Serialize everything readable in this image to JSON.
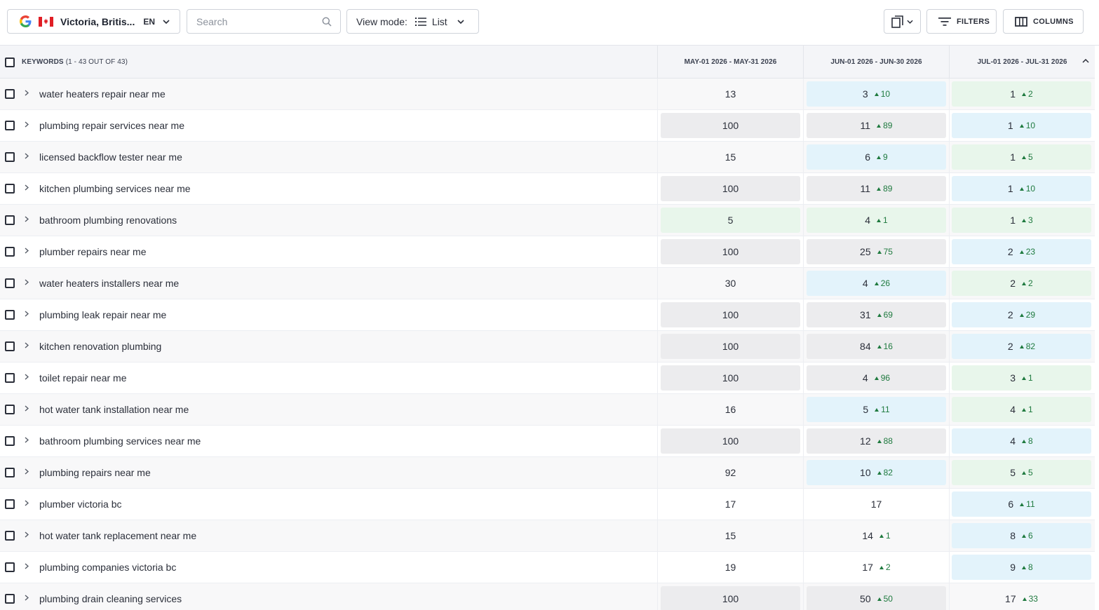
{
  "toolbar": {
    "location": "Victoria, Britis...",
    "language": "EN",
    "search_placeholder": "Search",
    "view_mode_label": "View mode:",
    "view_mode_value": "List",
    "filters_label": "FILTERS",
    "columns_label": "COLUMNS",
    "flag_colors": [
      "#e01e25",
      "#ffffff",
      "#e01e25"
    ]
  },
  "table": {
    "keywords_header": "KEYWORDS",
    "keywords_count": "(1 - 43 OUT OF 43)",
    "columns": [
      "MAY-01 2026 - MAY-31 2026",
      "JUN-01 2026 - JUN-30 2026",
      "JUL-01 2026 - JUL-31 2026"
    ],
    "colors": {
      "gray": "#ececee",
      "blue": "#e3f3fb",
      "green": "#e8f6eb",
      "delta": "#1f7a3f"
    },
    "rows": [
      {
        "keyword": "water heaters repair near me",
        "cells": [
          {
            "v": "13",
            "d": "",
            "bg": ""
          },
          {
            "v": "3",
            "d": "10",
            "bg": "blue"
          },
          {
            "v": "1",
            "d": "2",
            "bg": "green"
          }
        ]
      },
      {
        "keyword": "plumbing repair services near me",
        "cells": [
          {
            "v": "100",
            "d": "",
            "bg": "gray"
          },
          {
            "v": "11",
            "d": "89",
            "bg": "gray"
          },
          {
            "v": "1",
            "d": "10",
            "bg": "blue"
          }
        ]
      },
      {
        "keyword": "licensed backflow tester near me",
        "cells": [
          {
            "v": "15",
            "d": "",
            "bg": ""
          },
          {
            "v": "6",
            "d": "9",
            "bg": "blue"
          },
          {
            "v": "1",
            "d": "5",
            "bg": "green"
          }
        ]
      },
      {
        "keyword": "kitchen plumbing services near me",
        "cells": [
          {
            "v": "100",
            "d": "",
            "bg": "gray"
          },
          {
            "v": "11",
            "d": "89",
            "bg": "gray"
          },
          {
            "v": "1",
            "d": "10",
            "bg": "blue"
          }
        ]
      },
      {
        "keyword": "bathroom plumbing renovations",
        "cells": [
          {
            "v": "5",
            "d": "",
            "bg": "green"
          },
          {
            "v": "4",
            "d": "1",
            "bg": "green"
          },
          {
            "v": "1",
            "d": "3",
            "bg": "green"
          }
        ]
      },
      {
        "keyword": "plumber repairs near me",
        "cells": [
          {
            "v": "100",
            "d": "",
            "bg": "gray"
          },
          {
            "v": "25",
            "d": "75",
            "bg": "gray"
          },
          {
            "v": "2",
            "d": "23",
            "bg": "blue"
          }
        ]
      },
      {
        "keyword": "water heaters installers near me",
        "cells": [
          {
            "v": "30",
            "d": "",
            "bg": ""
          },
          {
            "v": "4",
            "d": "26",
            "bg": "blue"
          },
          {
            "v": "2",
            "d": "2",
            "bg": "green"
          }
        ]
      },
      {
        "keyword": "plumbing leak repair near me",
        "cells": [
          {
            "v": "100",
            "d": "",
            "bg": "gray"
          },
          {
            "v": "31",
            "d": "69",
            "bg": "gray"
          },
          {
            "v": "2",
            "d": "29",
            "bg": "blue"
          }
        ]
      },
      {
        "keyword": "kitchen renovation plumbing",
        "cells": [
          {
            "v": "100",
            "d": "",
            "bg": "gray"
          },
          {
            "v": "84",
            "d": "16",
            "bg": "gray"
          },
          {
            "v": "2",
            "d": "82",
            "bg": "blue"
          }
        ]
      },
      {
        "keyword": "toilet repair near me",
        "cells": [
          {
            "v": "100",
            "d": "",
            "bg": "gray"
          },
          {
            "v": "4",
            "d": "96",
            "bg": "gray"
          },
          {
            "v": "3",
            "d": "1",
            "bg": "green"
          }
        ]
      },
      {
        "keyword": "hot water tank installation near me",
        "cells": [
          {
            "v": "16",
            "d": "",
            "bg": ""
          },
          {
            "v": "5",
            "d": "11",
            "bg": "blue"
          },
          {
            "v": "4",
            "d": "1",
            "bg": "green"
          }
        ]
      },
      {
        "keyword": "bathroom plumbing services near me",
        "cells": [
          {
            "v": "100",
            "d": "",
            "bg": "gray"
          },
          {
            "v": "12",
            "d": "88",
            "bg": "gray"
          },
          {
            "v": "4",
            "d": "8",
            "bg": "blue"
          }
        ]
      },
      {
        "keyword": "plumbing repairs near me",
        "cells": [
          {
            "v": "92",
            "d": "",
            "bg": ""
          },
          {
            "v": "10",
            "d": "82",
            "bg": "blue"
          },
          {
            "v": "5",
            "d": "5",
            "bg": "green"
          }
        ]
      },
      {
        "keyword": "plumber victoria bc",
        "cells": [
          {
            "v": "17",
            "d": "",
            "bg": ""
          },
          {
            "v": "17",
            "d": "",
            "bg": ""
          },
          {
            "v": "6",
            "d": "11",
            "bg": "blue"
          }
        ]
      },
      {
        "keyword": "hot water tank replacement near me",
        "cells": [
          {
            "v": "15",
            "d": "",
            "bg": ""
          },
          {
            "v": "14",
            "d": "1",
            "bg": ""
          },
          {
            "v": "8",
            "d": "6",
            "bg": "blue"
          }
        ]
      },
      {
        "keyword": "plumbing companies victoria bc",
        "cells": [
          {
            "v": "19",
            "d": "",
            "bg": ""
          },
          {
            "v": "17",
            "d": "2",
            "bg": ""
          },
          {
            "v": "9",
            "d": "8",
            "bg": "blue"
          }
        ]
      },
      {
        "keyword": "plumbing drain cleaning services",
        "cells": [
          {
            "v": "100",
            "d": "",
            "bg": "gray"
          },
          {
            "v": "50",
            "d": "50",
            "bg": "gray"
          },
          {
            "v": "17",
            "d": "33",
            "bg": ""
          }
        ]
      }
    ]
  }
}
